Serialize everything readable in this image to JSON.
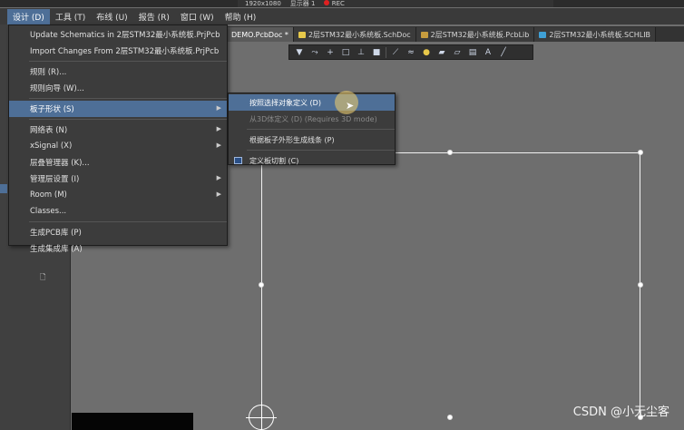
{
  "recorder": {
    "resolution": "1920x1080",
    "display": "显示器 1",
    "rec_label": "REC"
  },
  "menubar": [
    {
      "label": "设计 (D)",
      "active": true
    },
    {
      "label": "工具 (T)",
      "active": false
    },
    {
      "label": "布线 (U)",
      "active": false
    },
    {
      "label": "报告 (R)",
      "active": false
    },
    {
      "label": "窗口 (W)",
      "active": false
    },
    {
      "label": "帮助 (H)",
      "active": false
    }
  ],
  "tabs": [
    {
      "label": "DEMO.PcbDoc *",
      "active": true,
      "icon_color": "#c9a24a"
    },
    {
      "label": "2层STM32最小系统板.SchDoc",
      "active": false,
      "icon_color": "#e6c84a"
    },
    {
      "label": "2层STM32最小系统板.PcbLib",
      "active": false,
      "icon_color": "#c79c3e"
    },
    {
      "label": "2层STM32最小系统板.SCHLIB",
      "active": false,
      "icon_color": "#3fa0d6"
    }
  ],
  "toolbar_icons": [
    "filter-icon",
    "route-icon",
    "cross-icon",
    "select-rect-icon",
    "align-icon",
    "component-icon",
    "interactive-route-icon",
    "diff-pair-icon",
    "place-via-icon",
    "polygon-icon",
    "keepout-icon",
    "dimension-icon",
    "text-icon",
    "line-icon"
  ],
  "design_menu": {
    "items": [
      {
        "label": "Update Schematics in 2层STM32最小系统板.PrjPcb",
        "has_submenu": false
      },
      {
        "label": "Import Changes From 2层STM32最小系统板.PrjPcb",
        "has_submenu": false
      },
      {
        "separator": true
      },
      {
        "label": "规则 (R)...",
        "has_submenu": false
      },
      {
        "label": "规则向导 (W)...",
        "has_submenu": false
      },
      {
        "separator": true
      },
      {
        "label": "板子形状 (S)",
        "has_submenu": true,
        "hover": true
      },
      {
        "separator": true
      },
      {
        "label": "网络表 (N)",
        "has_submenu": true
      },
      {
        "label": "xSignal (X)",
        "has_submenu": true
      },
      {
        "label": "层叠管理器 (K)...",
        "has_submenu": false
      },
      {
        "label": "管理层设置 (I)",
        "has_submenu": true
      },
      {
        "label": "Room (M)",
        "has_submenu": true
      },
      {
        "label": "Classes...",
        "has_submenu": false
      },
      {
        "separator": true
      },
      {
        "label": "生成PCB库 (P)",
        "has_submenu": false
      },
      {
        "label": "生成集成库 (A)",
        "has_submenu": false
      }
    ]
  },
  "board_shape_submenu": {
    "items": [
      {
        "label": "按照选择对象定义 (D)",
        "hover": true,
        "disabled": false,
        "icon": false
      },
      {
        "label": "从3D体定义 (D) (Requires 3D mode)",
        "hover": false,
        "disabled": true,
        "icon": false
      },
      {
        "separator": true
      },
      {
        "label": "根据板子外形生成线条 (P)",
        "hover": false,
        "disabled": false,
        "icon": false
      },
      {
        "separator": true
      },
      {
        "label": "定义板切割 (C)",
        "hover": false,
        "disabled": false,
        "icon": true
      }
    ]
  },
  "watermark": "CSDN @小无尘客",
  "colors": {
    "accent": "#4e6f97",
    "canvas": "#6e6e6e",
    "menu_bg": "#3c3c3c"
  }
}
